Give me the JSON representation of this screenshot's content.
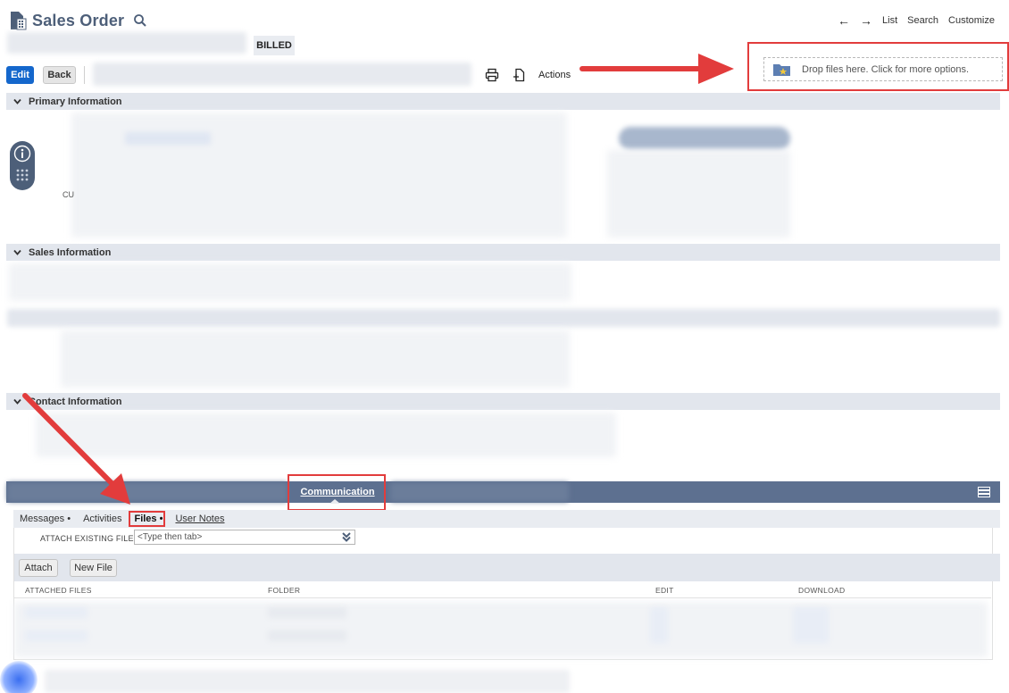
{
  "header": {
    "title": "Sales Order",
    "status": "BILLED"
  },
  "topnav": {
    "prev_icon": "arrow-left-icon",
    "next_icon": "arrow-right-icon",
    "list": "List",
    "search": "Search",
    "customize": "Customize"
  },
  "toolbar": {
    "edit": "Edit",
    "back": "Back",
    "actions": "Actions"
  },
  "dropzone": {
    "text": "Drop files here. Click for more options."
  },
  "sections": {
    "primary": "Primary Information",
    "sales": "Sales Information",
    "contact": "Contact Information"
  },
  "primary_fragment": "CU",
  "subtabs": {
    "main": "Communication",
    "items": [
      {
        "label": "Messages",
        "suffix": " •"
      },
      {
        "label": "Activities",
        "suffix": ""
      },
      {
        "label": "Files",
        "suffix": " •"
      },
      {
        "label": "User Notes",
        "suffix": ""
      }
    ]
  },
  "files": {
    "attach_label": "ATTACH EXISTING FILES",
    "attach_placeholder": "<Type then tab>",
    "attach_button": "Attach",
    "new_file_button": "New File",
    "columns": [
      "ATTACHED FILES",
      "FOLDER",
      "EDIT",
      "DOWNLOAD"
    ]
  },
  "colors": {
    "brand_blue": "#1467cc",
    "header_slate": "#4d5f79",
    "tab_bar": "#5d7090",
    "annotation_red": "#e23c3c"
  }
}
